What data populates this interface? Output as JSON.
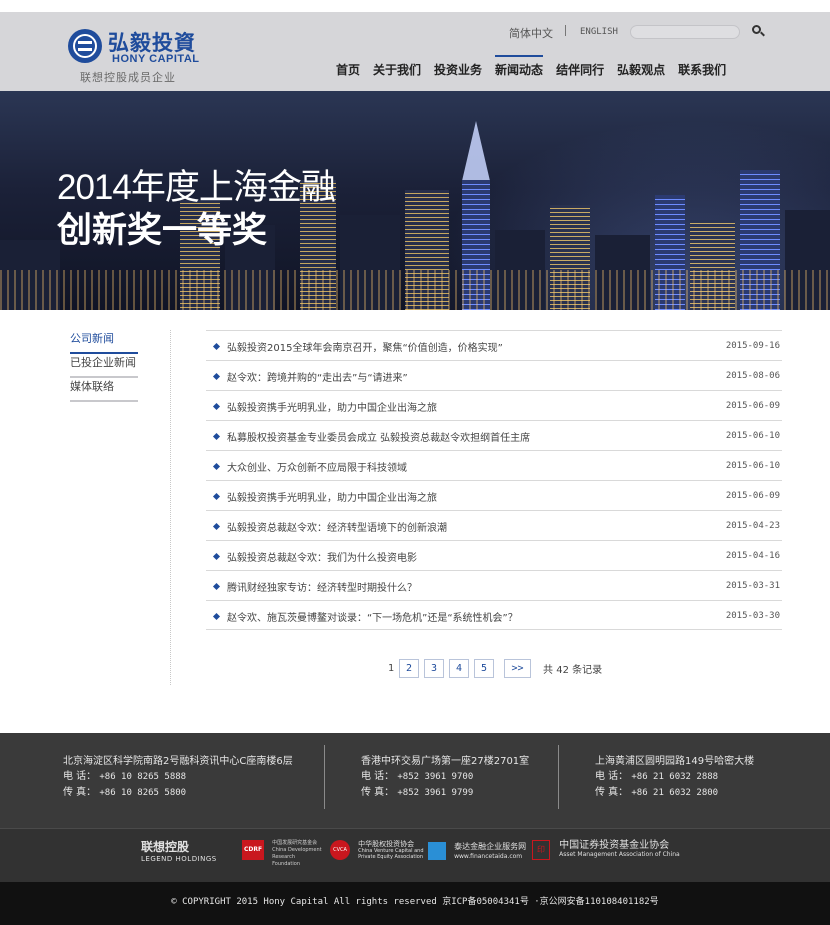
{
  "brand": {
    "logo_cn": "弘毅投資",
    "logo_en": "HONY CAPITAL",
    "logo_sub": "联想控股成员企业",
    "accent_color": "#1f4c9c"
  },
  "header": {
    "lang_cn": "简体中文",
    "lang_en": "ENGLISH",
    "search_placeholder": "",
    "nav": [
      "首页",
      "关于我们",
      "投资业务",
      "新闻动态",
      "结伴同行",
      "弘毅观点",
      "联系我们"
    ],
    "active_nav": "新闻动态"
  },
  "banner": {
    "line1": "2014年度上海金融",
    "line2": "创新奖一等奖"
  },
  "sidebar": {
    "items": [
      "公司新闻",
      "已投企业新闻",
      "媒体联络"
    ],
    "active": "公司新闻"
  },
  "news": [
    {
      "title": "弘毅投资2015全球年会南京召开，聚焦“价值创造，价格实现”",
      "date": "2015-09-16"
    },
    {
      "title": "赵令欢：跨境并购的“走出去”与“请进来”",
      "date": "2015-08-06"
    },
    {
      "title": "弘毅投资携手光明乳业，助力中国企业出海之旅",
      "date": "2015-06-09"
    },
    {
      "title": "私募股权投资基金专业委员会成立 弘毅投资总裁赵令欢担纲首任主席",
      "date": "2015-06-10"
    },
    {
      "title": "大众创业、万众创新不应局限于科技领域",
      "date": "2015-06-10"
    },
    {
      "title": "弘毅投资携手光明乳业，助力中国企业出海之旅",
      "date": "2015-06-09"
    },
    {
      "title": "弘毅投资总裁赵令欢：经济转型语境下的创新浪潮",
      "date": "2015-04-23"
    },
    {
      "title": "弘毅投资总裁赵令欢：我们为什么投资电影",
      "date": "2015-04-16"
    },
    {
      "title": "腾讯财经独家专访：经济转型时期投什么？",
      "date": "2015-03-31"
    },
    {
      "title": "赵令欢、施瓦茨曼博鳌对谈录：“下一场危机”还是“系统性机会”？",
      "date": "2015-03-30"
    }
  ],
  "pager": {
    "current": "1",
    "pages": [
      "2",
      "3",
      "4",
      "5"
    ],
    "next": ">>",
    "total_prefix": "共",
    "total": "42",
    "total_suffix": "条记录"
  },
  "footer": {
    "offices": [
      {
        "address": "北京海淀区科学院南路2号融科资讯中心C座南楼6层",
        "phone_label": "电  话：",
        "phone": "+86 10 8265 5888",
        "fax_label": "传  真：",
        "fax": "+86 10 8265 5800"
      },
      {
        "address": "香港中环交易广场第一座27楼2701室",
        "phone_label": "电  话：",
        "phone": "+852 3961 9700",
        "fax_label": "传  真：",
        "fax": "+852 3961 9799"
      },
      {
        "address": "上海黄浦区圆明园路149号哈密大楼",
        "phone_label": "电  话：",
        "phone": "+86 21 6032 2888",
        "fax_label": "传  真：",
        "fax": "+86 21 6032 2800"
      }
    ],
    "partners": {
      "legend_cn": "联想控股",
      "legend_en": "LEGEND HOLDINGS",
      "cdrf_badge": "CDRF",
      "cdrf_text": "中国发展研究基金会 China Development Research Foundation",
      "cvca_badge": "CVCA",
      "cvca_text_cn": "中华股权投资协会",
      "cvca_text_en": "China Venture Capital and Private Equity Association",
      "taida_text": "泰达金融企业服务网",
      "taida_url_text": "www.financetaida.com",
      "amac_badge": "印",
      "amac_text_cn": "中国证券投资基金业协会",
      "amac_text_en": "Asset Management Association of China"
    },
    "copyright": "© COPYRIGHT 2015 Hony Capital All rights reserved 京ICP备05004341号 ·京公网安备110108401182号"
  }
}
